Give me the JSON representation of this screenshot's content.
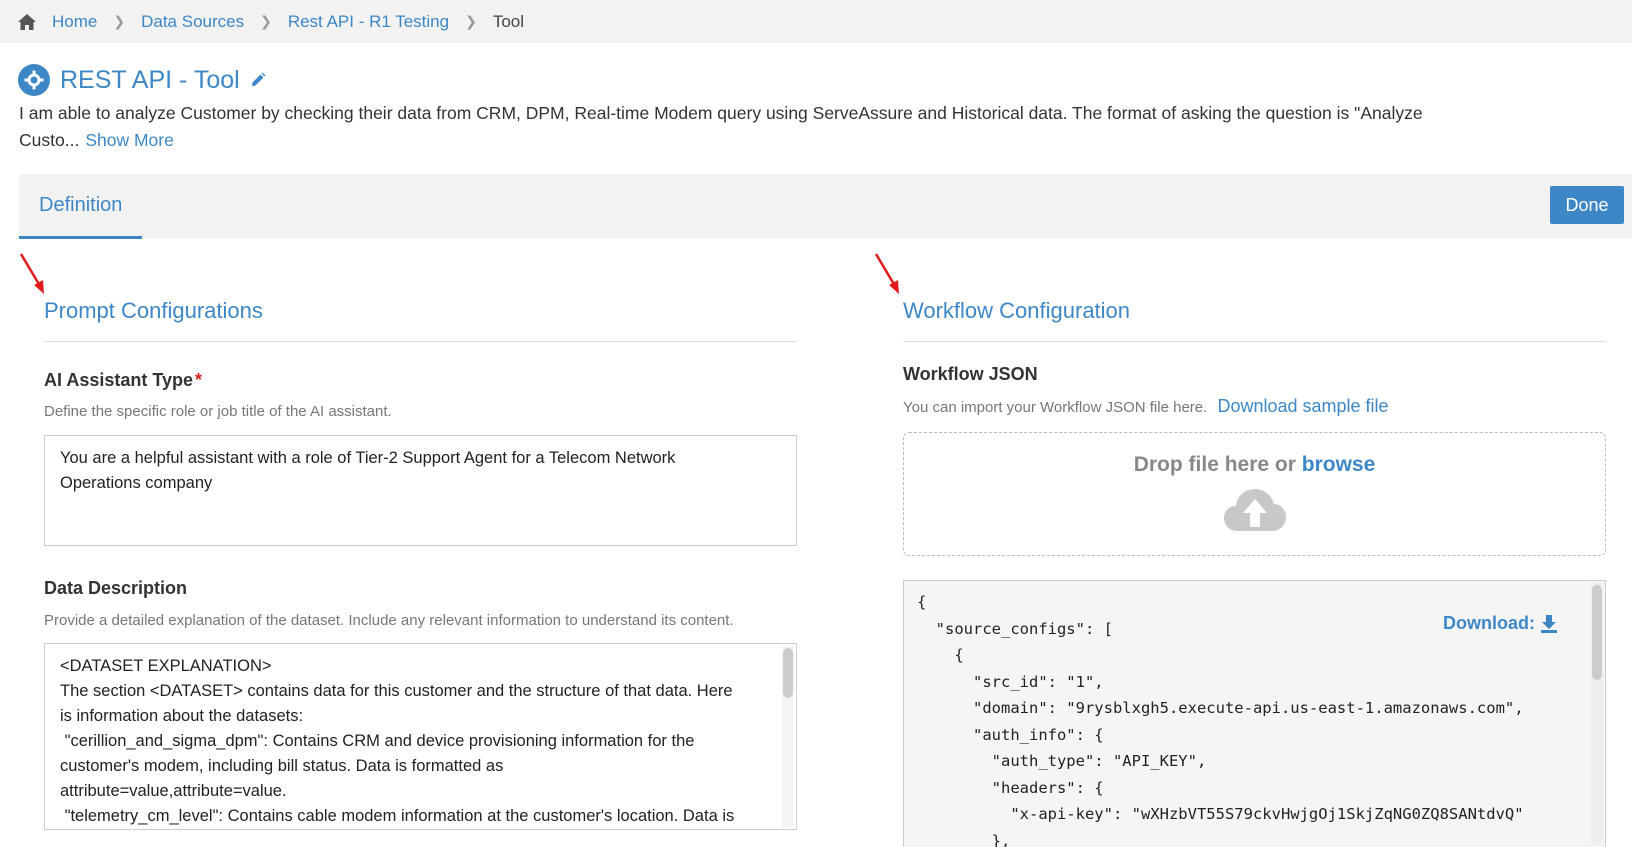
{
  "breadcrumb": {
    "items": [
      "Home",
      "Data Sources",
      "Rest API - R1 Testing"
    ],
    "current": "Tool"
  },
  "header": {
    "title": "REST API - Tool",
    "description": "I am able to analyze Customer by checking their data from CRM, DPM, Real-time Modem query using ServeAssure and Historical data. The format of asking the question is \"Analyze Custo...",
    "show_more": "Show More"
  },
  "tabs": {
    "definition": "Definition",
    "done_label": "Done"
  },
  "prompt": {
    "section_title": "Prompt Configurations",
    "assistant_type": {
      "label": "AI Assistant Type",
      "required_mark": "*",
      "hint": "Define the specific role or job title of the AI assistant.",
      "value": "You are a helpful assistant with a role of Tier-2 Support Agent for a Telecom Network Operations company"
    },
    "data_description": {
      "label": "Data Description",
      "hint": "Provide a detailed explanation of the dataset. Include any relevant information to understand its content.",
      "lines": [
        "<DATASET EXPLANATION>",
        "The section <DATASET> contains data for this customer and the structure of that data. Here",
        "is information about the datasets:",
        " \"cerillion_and_sigma_dpm\": Contains CRM and device provisioning information for the",
        "customer's modem, including bill status. Data is formatted as",
        "attribute=value,attribute=value.",
        " \"telemetry_cm_level\": Contains cable modem information at the customer's location. Data is"
      ]
    }
  },
  "workflow": {
    "section_title": "Workflow Configuration",
    "json_label": "Workflow JSON",
    "import_hint": "You can import your Workflow JSON file here.",
    "download_sample": "Download sample file",
    "drop_text": "Drop file here or",
    "browse": "browse",
    "download_label": "Download:",
    "code_lines": [
      "{",
      "  \"source_configs\": [",
      "    {",
      "      \"src_id\": \"1\",",
      "      \"domain\": \"9rysblxgh5.execute-api.us-east-1.amazonaws.com\",",
      "      \"auth_info\": {",
      "        \"auth_type\": \"API_KEY\",",
      "        \"headers\": {",
      "          \"x-api-key\": \"wXHzbVT55S79ckvHwjgOj1SkjZqNG0ZQ8SANtdvQ\"",
      "        },"
    ]
  },
  "colors": {
    "accent": "#3d87c7",
    "required": "#d9241c",
    "annotation_arrow": "#e01b1b"
  }
}
